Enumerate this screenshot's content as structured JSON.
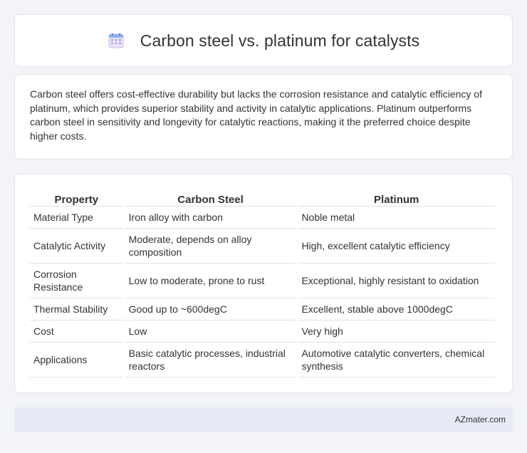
{
  "header": {
    "icon": "calendar-icon",
    "title": "Carbon steel vs. platinum for catalysts"
  },
  "summary": {
    "text": "Carbon steel offers cost-effective durability but lacks the corrosion resistance and catalytic efficiency of platinum, which provides superior stability and activity in catalytic applications. Platinum outperforms carbon steel in sensitivity and longevity for catalytic reactions, making it the preferred choice despite higher costs."
  },
  "table": {
    "headers": [
      "Property",
      "Carbon Steel",
      "Platinum"
    ],
    "rows": [
      [
        "Material Type",
        "Iron alloy with carbon",
        "Noble metal"
      ],
      [
        "Catalytic Activity",
        "Moderate, depends on alloy composition",
        "High, excellent catalytic efficiency"
      ],
      [
        "Corrosion Resistance",
        "Low to moderate, prone to rust",
        "Exceptional, highly resistant to oxidation"
      ],
      [
        "Thermal Stability",
        "Good up to ~600degC",
        "Excellent, stable above 1000degC"
      ],
      [
        "Cost",
        "Low",
        "Very high"
      ],
      [
        "Applications",
        "Basic catalytic processes, industrial reactors",
        "Automotive catalytic converters, chemical synthesis"
      ]
    ]
  },
  "footer": {
    "brand": "AZmater.com"
  },
  "colors": {
    "background": "#f3f4f7",
    "card": "#ffffff",
    "footer_bg": "#e6ebf5",
    "text": "#333333"
  }
}
